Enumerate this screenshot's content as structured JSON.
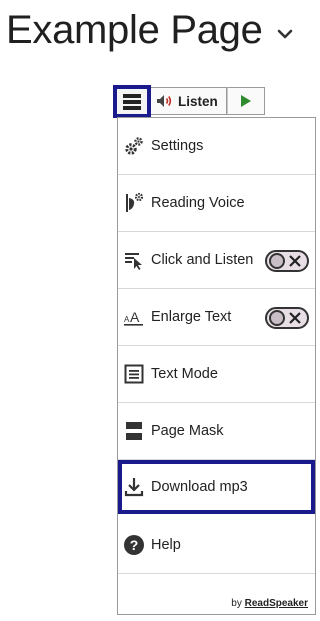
{
  "page": {
    "title": "Example Page"
  },
  "toolbar": {
    "listen_label": "Listen"
  },
  "menu": {
    "items": [
      {
        "label": "Settings"
      },
      {
        "label": "Reading Voice"
      },
      {
        "label": "Click and Listen",
        "toggle": "off"
      },
      {
        "label": "Enlarge Text",
        "toggle": "off"
      },
      {
        "label": "Text Mode"
      },
      {
        "label": "Page Mask"
      },
      {
        "label": "Download mp3"
      },
      {
        "label": "Help"
      }
    ],
    "footer_by": "by",
    "footer_brand": "ReadSpeaker"
  },
  "colors": {
    "highlight": "#1a1a8c",
    "play_green": "#2e8b2e",
    "speaker_red": "#c0302a"
  },
  "icons": [
    "chevron-down-icon",
    "hamburger-icon",
    "speaker-icon",
    "play-icon",
    "gears-icon",
    "reading-voice-icon",
    "click-listen-icon",
    "enlarge-text-icon",
    "text-mode-icon",
    "page-mask-icon",
    "download-icon",
    "help-icon"
  ]
}
